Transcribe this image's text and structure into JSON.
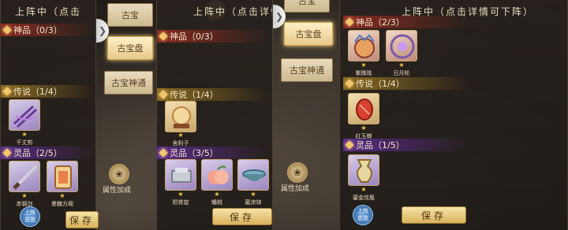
{
  "colors": {
    "accent_gold": "#f2c66a",
    "red_band": "#8a2a20",
    "gold_band": "#8a6a20",
    "purple_band": "#5a2a8a",
    "star": "#f5c842"
  },
  "panel1": {
    "title": "上阵中（点击",
    "cat_shenpin": "神品（0/3）",
    "cat_chuanshuo": "传说（1/4）",
    "cat_lingpin": "灵品（2/5）",
    "items": [
      {
        "name": "千丈剪",
        "stars": "★"
      },
      {
        "name": "赤钢剑",
        "stars": "★"
      },
      {
        "name": "墨糖方阁",
        "stars": "★"
      }
    ],
    "overview_1": "上阵",
    "overview_2": "总览",
    "save": "保存"
  },
  "tabs1": {
    "gubao": "古宝",
    "gubaopan": "古宝盘",
    "gubaoshentong": "古宝神通",
    "attr": "属性加成"
  },
  "panel2": {
    "title": "上阵中（点击详情可",
    "cat_shenpin": "神品（0/3）",
    "cat_chuanshuo": "传说（1/4）",
    "cat_lingpin": "灵品（3/5）",
    "items": [
      {
        "name": "舍利子",
        "stars": "★"
      },
      {
        "name": "陨铁锭",
        "stars": "★"
      },
      {
        "name": "蟠桃",
        "stars": "★"
      },
      {
        "name": "龍凉钵",
        "stars": "★"
      }
    ],
    "save": "保存"
  },
  "tabs2": {
    "gubao": "古宝",
    "gubaopan": "古宝盘",
    "gubaoshentong": "古宝神通",
    "attr": "属性加成"
  },
  "panel3": {
    "title": "上阵中（点击详情可下阵）",
    "cat_shenpin": "神品（2/3）",
    "cat_chuanshuo": "传说（1/4）",
    "cat_lingpin": "灵品（1/5）",
    "items": [
      {
        "name": "紫微珠",
        "stars": "★"
      },
      {
        "name": "日月轮",
        "stars": "★"
      },
      {
        "name": "红玉蝉",
        "stars": "★"
      },
      {
        "name": "鎏金炫瓶",
        "stars": "★"
      }
    ],
    "overview_1": "上阵",
    "overview_2": "总览",
    "save": "保存"
  }
}
